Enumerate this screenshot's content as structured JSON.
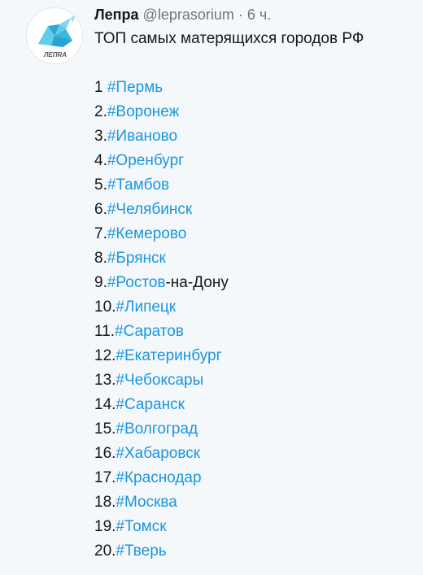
{
  "account": {
    "name": "Лепра",
    "handle": "@leprasorium",
    "separator": "·",
    "time": "6 ч.",
    "avatar_text": "ЛЕПRA",
    "avatar_color": "#4fc3e6"
  },
  "tweet": {
    "headline": "ТОП самых матерящихся городов РФ",
    "link_color": "#1b95e0",
    "items": [
      {
        "num": "1 ",
        "tag": "#Пермь",
        "suffix": ""
      },
      {
        "num": "2.",
        "tag": "#Воронеж",
        "suffix": ""
      },
      {
        "num": "3.",
        "tag": "#Иваново",
        "suffix": ""
      },
      {
        "num": "4.",
        "tag": "#Оренбург",
        "suffix": ""
      },
      {
        "num": "5.",
        "tag": "#Тамбов",
        "suffix": ""
      },
      {
        "num": "6.",
        "tag": "#Челябинск",
        "suffix": ""
      },
      {
        "num": "7.",
        "tag": "#Кемерово",
        "suffix": ""
      },
      {
        "num": "8.",
        "tag": "#Брянск",
        "suffix": ""
      },
      {
        "num": "9.",
        "tag": "#Ростов",
        "suffix": "-на-Дону"
      },
      {
        "num": "10.",
        "tag": "#Липецк",
        "suffix": ""
      },
      {
        "num": "11.",
        "tag": "#Саратов",
        "suffix": ""
      },
      {
        "num": "12.",
        "tag": "#Екатеринбург",
        "suffix": ""
      },
      {
        "num": "13.",
        "tag": "#Чебоксары",
        "suffix": ""
      },
      {
        "num": "14.",
        "tag": "#Саранск",
        "suffix": ""
      },
      {
        "num": "15.",
        "tag": "#Волгоград",
        "suffix": ""
      },
      {
        "num": "16.",
        "tag": "#Хабаровск",
        "suffix": ""
      },
      {
        "num": "17.",
        "tag": "#Краснодар",
        "suffix": ""
      },
      {
        "num": "18.",
        "tag": "#Москва",
        "suffix": ""
      },
      {
        "num": "19.",
        "tag": "#Томск",
        "suffix": ""
      },
      {
        "num": "20.",
        "tag": "#Тверь",
        "suffix": ""
      }
    ]
  }
}
